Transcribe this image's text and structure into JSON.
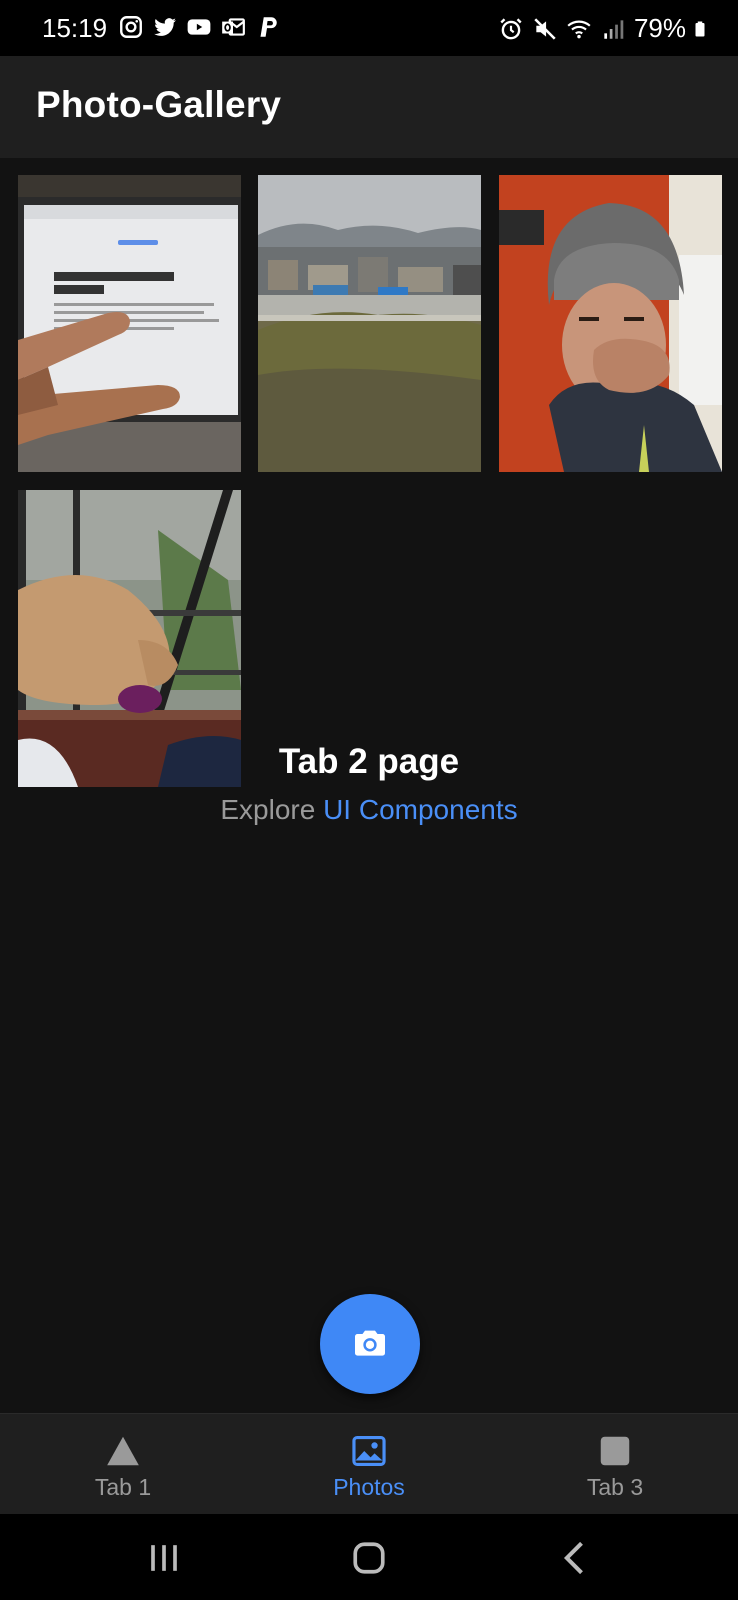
{
  "status_bar": {
    "time": "15:19",
    "left_icons": [
      "instagram-icon",
      "twitter-icon",
      "youtube-icon",
      "outlook-icon",
      "paypal-icon"
    ],
    "right_icons": [
      "alarm-icon",
      "mute-icon",
      "wifi-icon",
      "signal-icon",
      "battery-icon"
    ],
    "battery": "79%"
  },
  "header": {
    "title": "Photo-Gallery"
  },
  "gallery": {
    "photos": [
      {
        "alt": "laptop-photo"
      },
      {
        "alt": "rooftop-photo"
      },
      {
        "alt": "selfie-photo"
      },
      {
        "alt": "cat-photo"
      }
    ]
  },
  "content": {
    "title": "Tab 2 page",
    "explore_prefix": "Explore",
    "explore_link": "UI Components"
  },
  "fab": {
    "icon": "camera-icon"
  },
  "tabs": [
    {
      "label": "Tab 1",
      "icon": "triangle-icon",
      "active": false
    },
    {
      "label": "Photos",
      "icon": "images-icon",
      "active": true
    },
    {
      "label": "Tab 3",
      "icon": "square-icon",
      "active": false
    }
  ],
  "colors": {
    "accent": "#3f88f6",
    "background": "#121212",
    "toolbar": "#1f1f1f"
  },
  "system_nav": [
    "recents-button",
    "home-button",
    "back-button"
  ]
}
